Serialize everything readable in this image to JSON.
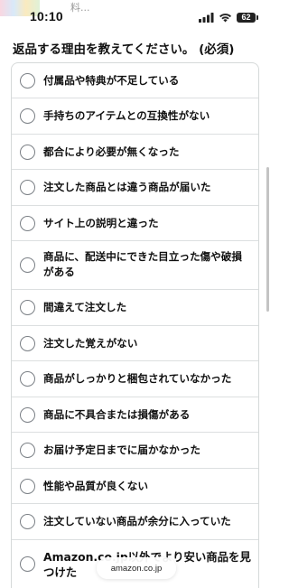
{
  "status_bar": {
    "time": "10:10",
    "battery": "62",
    "peek_text": "料..."
  },
  "question": {
    "title": "返品する理由を教えてください。 (必須)"
  },
  "options": [
    {
      "label": "付属品や特典が不足している"
    },
    {
      "label": "手持ちのアイテムとの互換性がない"
    },
    {
      "label": "都合により必要が無くなった"
    },
    {
      "label": "注文した商品とは違う商品が届いた"
    },
    {
      "label": "サイト上の説明と違った"
    },
    {
      "label": "商品に、配送中にできた目立った傷や破損がある"
    },
    {
      "label": "間違えて注文した"
    },
    {
      "label": "注文した覚えがない"
    },
    {
      "label": "商品がしっかりと梱包されていなかった"
    },
    {
      "label": "商品に不具合または損傷がある"
    },
    {
      "label": "お届け予定日までに届かなかった"
    },
    {
      "label": "性能や品質が良くない"
    },
    {
      "label": "注文していない商品が余分に入っていた"
    },
    {
      "label": "Amazon.co.jp以外でより安い商品を見つけた"
    }
  ],
  "browser": {
    "url": "amazon.co.jp"
  }
}
